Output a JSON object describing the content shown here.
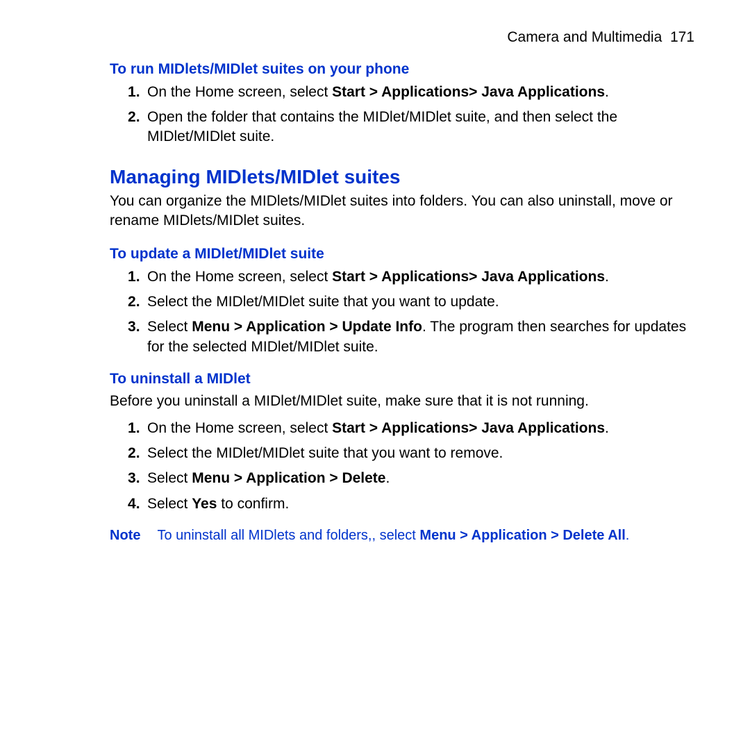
{
  "header": {
    "chapter": "Camera and Multimedia",
    "page": "171"
  },
  "section_run": {
    "title": "To run MIDlets/MIDlet suites on your phone",
    "steps": [
      {
        "pre": "On the Home screen, select ",
        "bold": "Start > Applications> Java Applications",
        "post": "."
      },
      {
        "pre": "Open the folder that contains the MIDlet/MIDlet suite, and then select the MIDlet/MIDlet suite."
      }
    ]
  },
  "managing": {
    "title": "Managing MIDlets/MIDlet suites",
    "lead": "You can organize the MIDlets/MIDlet suites into folders. You can also uninstall, move or rename MIDlets/MIDlet suites."
  },
  "section_update": {
    "title": "To update a MIDlet/MIDlet suite",
    "steps": [
      {
        "pre": "On the Home screen, select ",
        "bold": "Start > Applications> Java Applications",
        "post": "."
      },
      {
        "pre": "Select the MIDlet/MIDlet suite that you want to update."
      },
      {
        "pre": "Select ",
        "bold": "Menu > Application > Update Info",
        "post": ". The program then searches for updates for the selected MIDlet/MIDlet suite."
      }
    ]
  },
  "section_uninstall": {
    "title": "To uninstall a MIDlet",
    "lead": "Before you uninstall a MIDlet/MIDlet suite, make sure that it is not running.",
    "steps": [
      {
        "pre": "On the Home screen, select ",
        "bold": "Start > Applications> Java Applications",
        "post": "."
      },
      {
        "pre": " Select the MIDlet/MIDlet suite that you want to remove."
      },
      {
        "pre": "Select ",
        "bold": "Menu > Application > Delete",
        "post": "."
      },
      {
        "pre": "Select ",
        "bold": "Yes",
        "post": " to confirm."
      }
    ]
  },
  "note": {
    "label": "Note",
    "text_pre": "To uninstall all MIDlets and folders,, select ",
    "text_bold": "Menu > Application > Delete All",
    "text_post": "."
  }
}
